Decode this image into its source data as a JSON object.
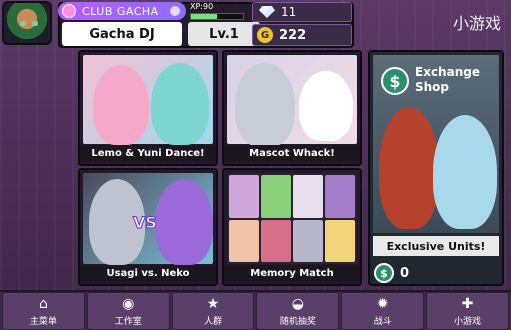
{
  "header": {
    "club_label": "CLUB GACHA",
    "xp_label": "XP:90",
    "xp_progress": 0.5,
    "player_name": "Gacha DJ",
    "level": "Lv.1",
    "gems": "11",
    "gold": "222",
    "gold_icon_letter": "G",
    "corner_title": "小游戏"
  },
  "games": [
    {
      "label": "Lemo & Yuni Dance!"
    },
    {
      "label": "Mascot Whack!"
    },
    {
      "label": "Usagi vs. Neko",
      "vs_text": "VS"
    },
    {
      "label": "Memory Match"
    }
  ],
  "shop": {
    "title_line1": "Exchange",
    "title_line2": "Shop",
    "icon_symbol": "$",
    "caption": "Exclusive Units!",
    "currency_value": "0"
  },
  "nav": {
    "items": [
      {
        "label": "主菜单",
        "icon": "home-icon",
        "glyph": "⌂"
      },
      {
        "label": "工作室",
        "icon": "camera-icon",
        "glyph": "◉"
      },
      {
        "label": "人群",
        "icon": "star-icon",
        "glyph": "★"
      },
      {
        "label": "随机抽奖",
        "icon": "capsule-icon",
        "glyph": "◒"
      },
      {
        "label": "战斗",
        "icon": "burst-icon",
        "glyph": "✹"
      },
      {
        "label": "小游戏",
        "icon": "gamepad-icon",
        "glyph": "✚"
      }
    ]
  },
  "colors": {
    "accent_purple": "#8e6cff",
    "shop_green": "#2a8f6a",
    "gold": "#f1c232"
  }
}
